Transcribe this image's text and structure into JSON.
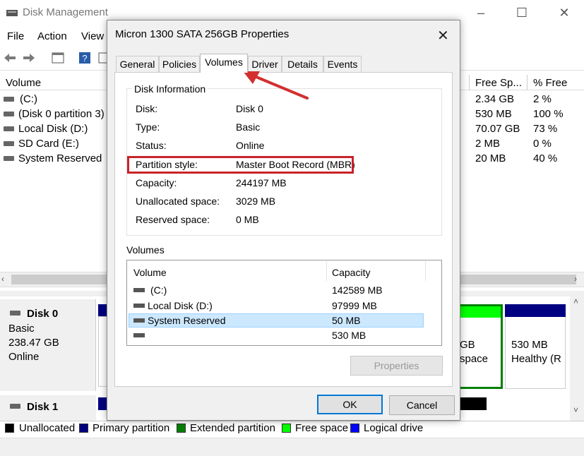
{
  "main_window": {
    "title": "Disk Management",
    "menu": [
      "File",
      "Action",
      "View"
    ],
    "columns": {
      "volume": "Volume",
      "free_space": "Free Sp...",
      "pct_free": "% Free"
    },
    "volumes": [
      {
        "name": "(C:)",
        "free": "2.34 GB",
        "pct": "2 %"
      },
      {
        "name": "(Disk 0 partition 3)",
        "free": "530 MB",
        "pct": "100 %"
      },
      {
        "name": "Local Disk (D:)",
        "free": "70.07 GB",
        "pct": "73 %"
      },
      {
        "name": "SD Card (E:)",
        "free": "2 MB",
        "pct": "0 %"
      },
      {
        "name": "System Reserved",
        "free": "20 MB",
        "pct": "40 %"
      }
    ],
    "disk0": {
      "name": "Disk 0",
      "type": "Basic",
      "size": "238.47 GB",
      "status": "Online"
    },
    "disk1": {
      "name": "Disk 1"
    },
    "partition_panel": {
      "line1": "530 MB",
      "line2": "Healthy (R"
    },
    "partial_panel": {
      "line1": "GB",
      "line2": "space"
    },
    "legend": [
      {
        "label": "Unallocated",
        "color": "#000000"
      },
      {
        "label": "Primary partition",
        "color": "#000080"
      },
      {
        "label": "Extended partition",
        "color": "#008000"
      },
      {
        "label": "Free space",
        "color": "#00ff00"
      },
      {
        "label": "Logical drive",
        "color": "#0000ff"
      }
    ]
  },
  "dialog": {
    "title": "Micron 1300 SATA 256GB Properties",
    "tabs": [
      "General",
      "Policies",
      "Volumes",
      "Driver",
      "Details",
      "Events"
    ],
    "active_tab": "Volumes",
    "disk_info_title": "Disk Information",
    "info": [
      {
        "key": "Disk:",
        "value": "Disk 0"
      },
      {
        "key": "Type:",
        "value": "Basic"
      },
      {
        "key": "Status:",
        "value": "Online"
      },
      {
        "key": "Partition style:",
        "value": "Master Boot Record (MBR)"
      },
      {
        "key": "Capacity:",
        "value": "244197 MB"
      },
      {
        "key": "Unallocated space:",
        "value": "3029 MB"
      },
      {
        "key": "Reserved space:",
        "value": "0 MB"
      }
    ],
    "volumes_label": "Volumes",
    "vol_headers": {
      "volume": "Volume",
      "capacity": "Capacity"
    },
    "vol_rows": [
      {
        "name": "(C:)",
        "capacity": "142589 MB"
      },
      {
        "name": "Local Disk (D:)",
        "capacity": "97999 MB"
      },
      {
        "name": "System Reserved",
        "capacity": "50 MB"
      },
      {
        "name": "",
        "capacity": "530 MB"
      }
    ],
    "selected_row": "System Reserved",
    "properties_button": "Properties",
    "ok_button": "OK",
    "cancel_button": "Cancel"
  },
  "annotation": {
    "highlight_color": "#c8232b",
    "arrow_color": "#d32f2f"
  }
}
